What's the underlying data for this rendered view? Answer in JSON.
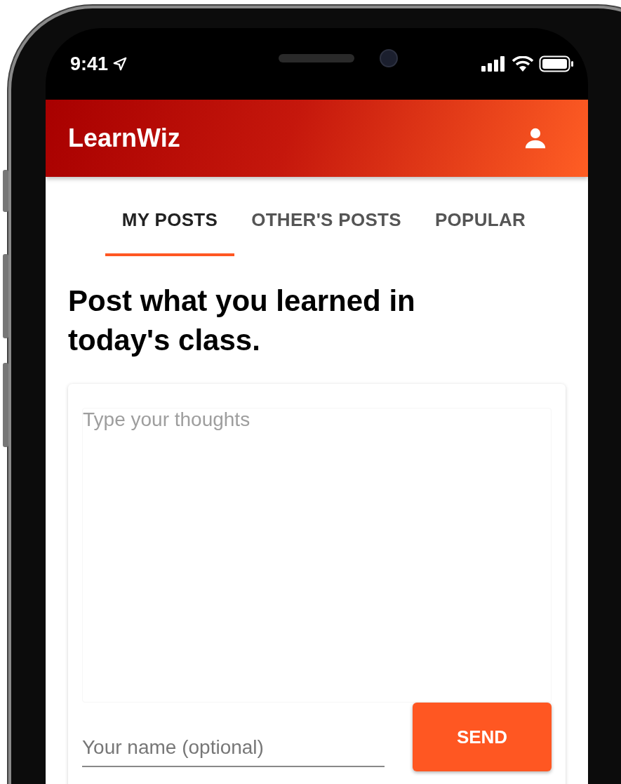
{
  "status_bar": {
    "time": "9:41"
  },
  "app_bar": {
    "title": "LearnWiz"
  },
  "tabs": [
    {
      "label": "MY POSTS",
      "selected": true
    },
    {
      "label": "OTHER'S POSTS",
      "selected": false
    },
    {
      "label": "POPULAR",
      "selected": false
    }
  ],
  "heading": "Post what you learned in today's class.",
  "post_form": {
    "thoughts_placeholder": "Type your thoughts",
    "name_placeholder": "Your name (optional)",
    "send_button": "SEND"
  }
}
